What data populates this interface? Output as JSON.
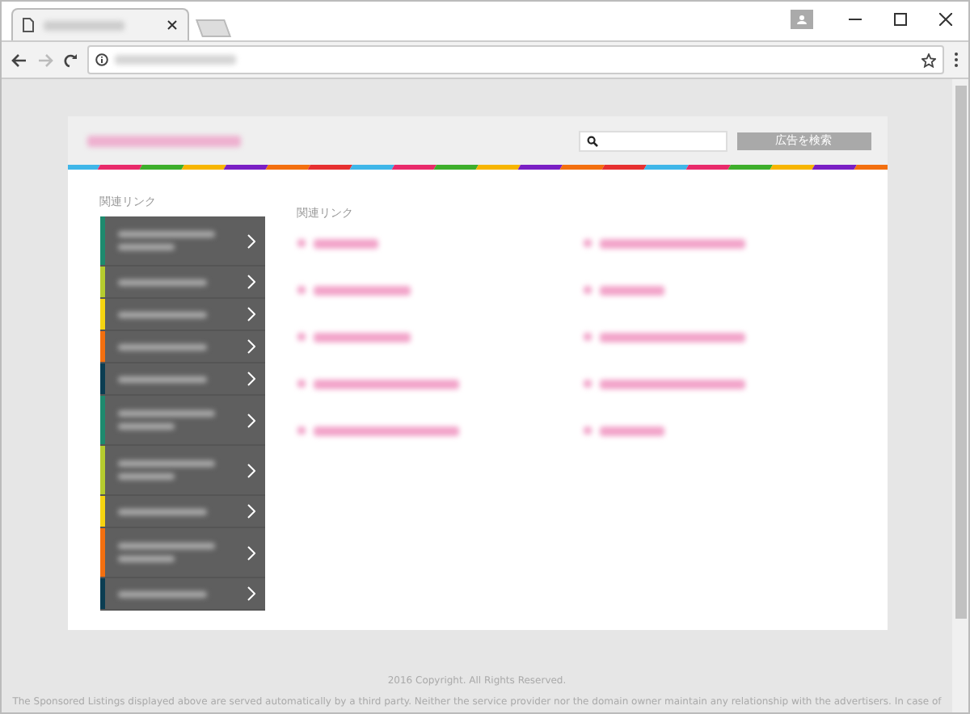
{
  "header": {
    "search_button": "広告を検索"
  },
  "sidebar": {
    "heading": "関連リンク",
    "items": [
      {
        "color": "#1e8a6e",
        "kind": "two-line"
      },
      {
        "color": "#b5cc2e",
        "kind": "one-line"
      },
      {
        "color": "#f6d410",
        "kind": "one-line"
      },
      {
        "color": "#f36f0f",
        "kind": "one-line"
      },
      {
        "color": "#0b3d52",
        "kind": "one-line"
      },
      {
        "color": "#1e8a6e",
        "kind": "two-line"
      },
      {
        "color": "#b5cc2e",
        "kind": "two-line"
      },
      {
        "color": "#f6d410",
        "kind": "one-line"
      },
      {
        "color": "#f36f0f",
        "kind": "two-line"
      },
      {
        "color": "#0b3d52",
        "kind": "one-line"
      }
    ]
  },
  "links": {
    "heading": "関連リンク",
    "columns": [
      [
        {
          "kind": "short"
        },
        {
          "kind": "medium"
        },
        {
          "kind": "medium"
        },
        {
          "kind": "long"
        },
        {
          "kind": "long"
        }
      ],
      [
        {
          "kind": "long"
        },
        {
          "kind": "short"
        },
        {
          "kind": "long"
        },
        {
          "kind": "long"
        },
        {
          "kind": "short"
        }
      ]
    ]
  },
  "footer": {
    "copyright": "2016 Copyright. All Rights Reserved.",
    "disclaimer": "The Sponsored Listings displayed above are served automatically by a third party. Neither the service provider nor the domain owner maintain any relationship with the advertisers. In case of"
  }
}
